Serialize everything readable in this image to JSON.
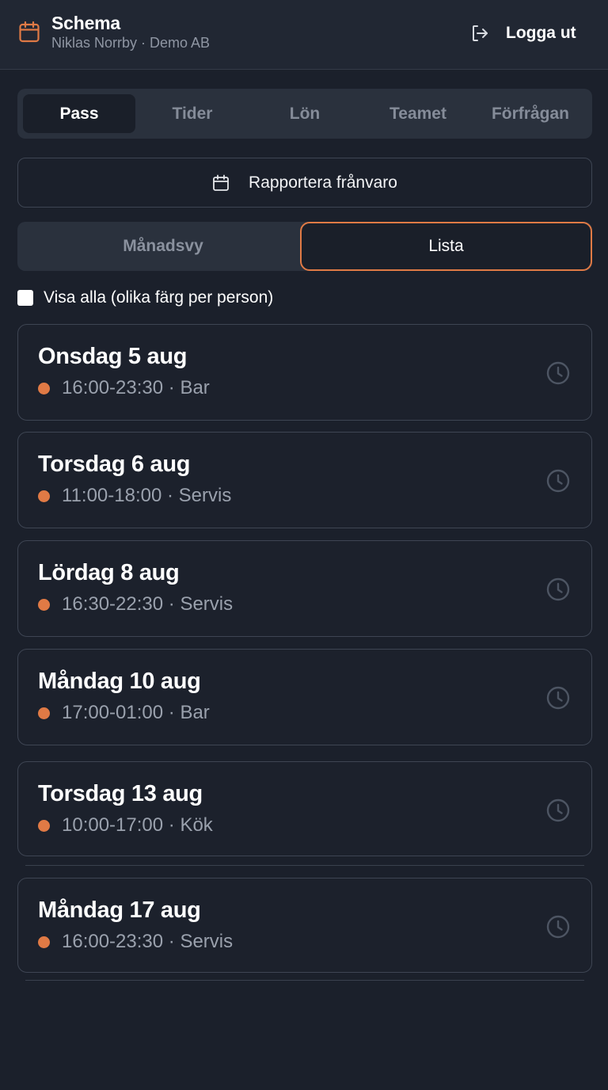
{
  "header": {
    "title": "Schema",
    "subtitle": "Niklas Norrby · Demo AB",
    "logout_label": "Logga ut",
    "icon": "calendar-icon"
  },
  "tabs": [
    {
      "label": "Pass",
      "active": true
    },
    {
      "label": "Tider",
      "active": false
    },
    {
      "label": "Lön",
      "active": false
    },
    {
      "label": "Teamet",
      "active": false
    },
    {
      "label": "Förfrågan",
      "active": false
    }
  ],
  "report_absence": {
    "label": "Rapportera frånvaro",
    "icon": "calendar-icon"
  },
  "view_toggle": {
    "month_label": "Månadsvy",
    "list_label": "Lista",
    "selected": "Lista"
  },
  "show_all": {
    "label": "Visa alla (olika färg per person)",
    "checked": false
  },
  "shifts": [
    {
      "date": "Onsdag 5 aug",
      "detail": "16:00-23:30 · Bar"
    },
    {
      "date": "Torsdag 6 aug",
      "detail": "11:00-18:00 · Servis"
    },
    {
      "date": "Lördag 8 aug",
      "detail": "16:30-22:30 · Servis"
    },
    {
      "date": "Måndag 10 aug",
      "detail": "17:00-01:00 · Bar"
    },
    {
      "date": "Torsdag 13 aug",
      "detail": "10:00-17:00 · Kök"
    },
    {
      "date": "Måndag 17 aug",
      "detail": "16:00-23:30 · Servis"
    }
  ],
  "colors": {
    "accent": "#e07a45",
    "background": "#1b202b",
    "header_bg": "#212733",
    "muted_text": "#8f96a3"
  }
}
